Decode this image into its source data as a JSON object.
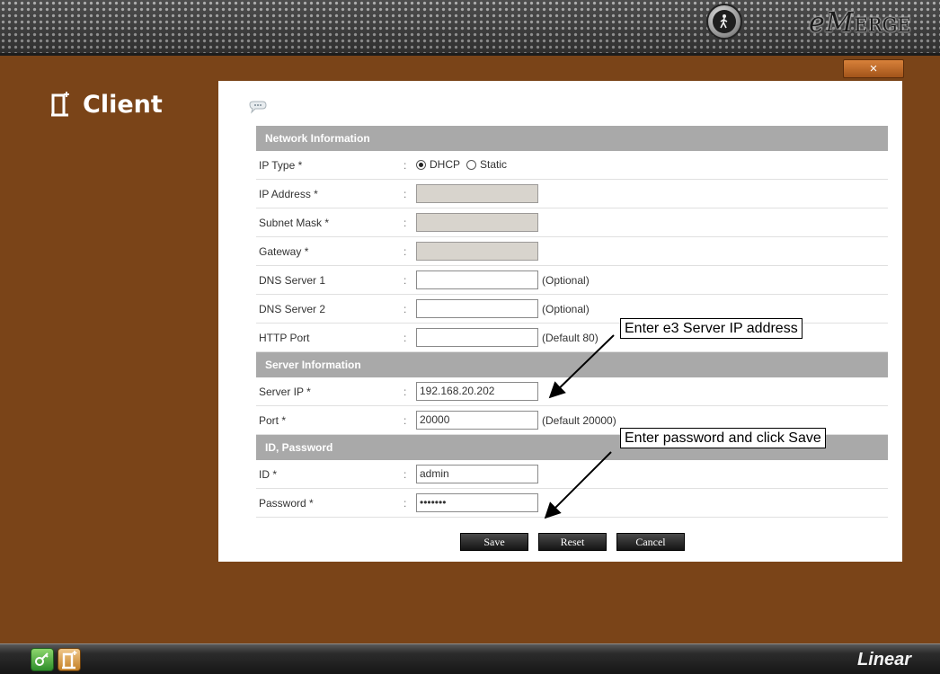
{
  "header": {
    "brand_main": "eM",
    "brand_rest": "ERGE"
  },
  "close_label": "×",
  "page_title": "Client",
  "sections": {
    "network": "Network Information",
    "server": "Server Information",
    "credentials": "ID, Password"
  },
  "fields": {
    "ip_type": {
      "label": "IP Type *",
      "options": [
        "DHCP",
        "Static"
      ],
      "selected": "DHCP"
    },
    "ip_address": {
      "label": "IP Address *",
      "value": ""
    },
    "subnet_mask": {
      "label": "Subnet Mask *",
      "value": ""
    },
    "gateway": {
      "label": "Gateway *",
      "value": ""
    },
    "dns1": {
      "label": "DNS Server 1",
      "value": "",
      "hint": "(Optional)"
    },
    "dns2": {
      "label": "DNS Server 2",
      "value": "",
      "hint": "(Optional)"
    },
    "http_port": {
      "label": "HTTP Port",
      "value": "",
      "hint": "(Default 80)"
    },
    "server_ip": {
      "label": "Server IP *",
      "value": "192.168.20.202"
    },
    "port": {
      "label": "Port *",
      "value": "20000",
      "hint": "(Default 20000)"
    },
    "id": {
      "label": "ID *",
      "value": "admin"
    },
    "password": {
      "label": "Password *",
      "value": "•••••••"
    }
  },
  "colon": ":",
  "buttons": {
    "save": "Save",
    "reset": "Reset",
    "cancel": "Cancel"
  },
  "annotations": {
    "server_ip": "Enter e3 Server IP address",
    "password": "Enter password and click Save"
  },
  "footer": {
    "brand": "Linear"
  },
  "colors": {
    "background": "#7a4418",
    "section_header": "#a9a9a9",
    "close_button": "#c06a28"
  }
}
